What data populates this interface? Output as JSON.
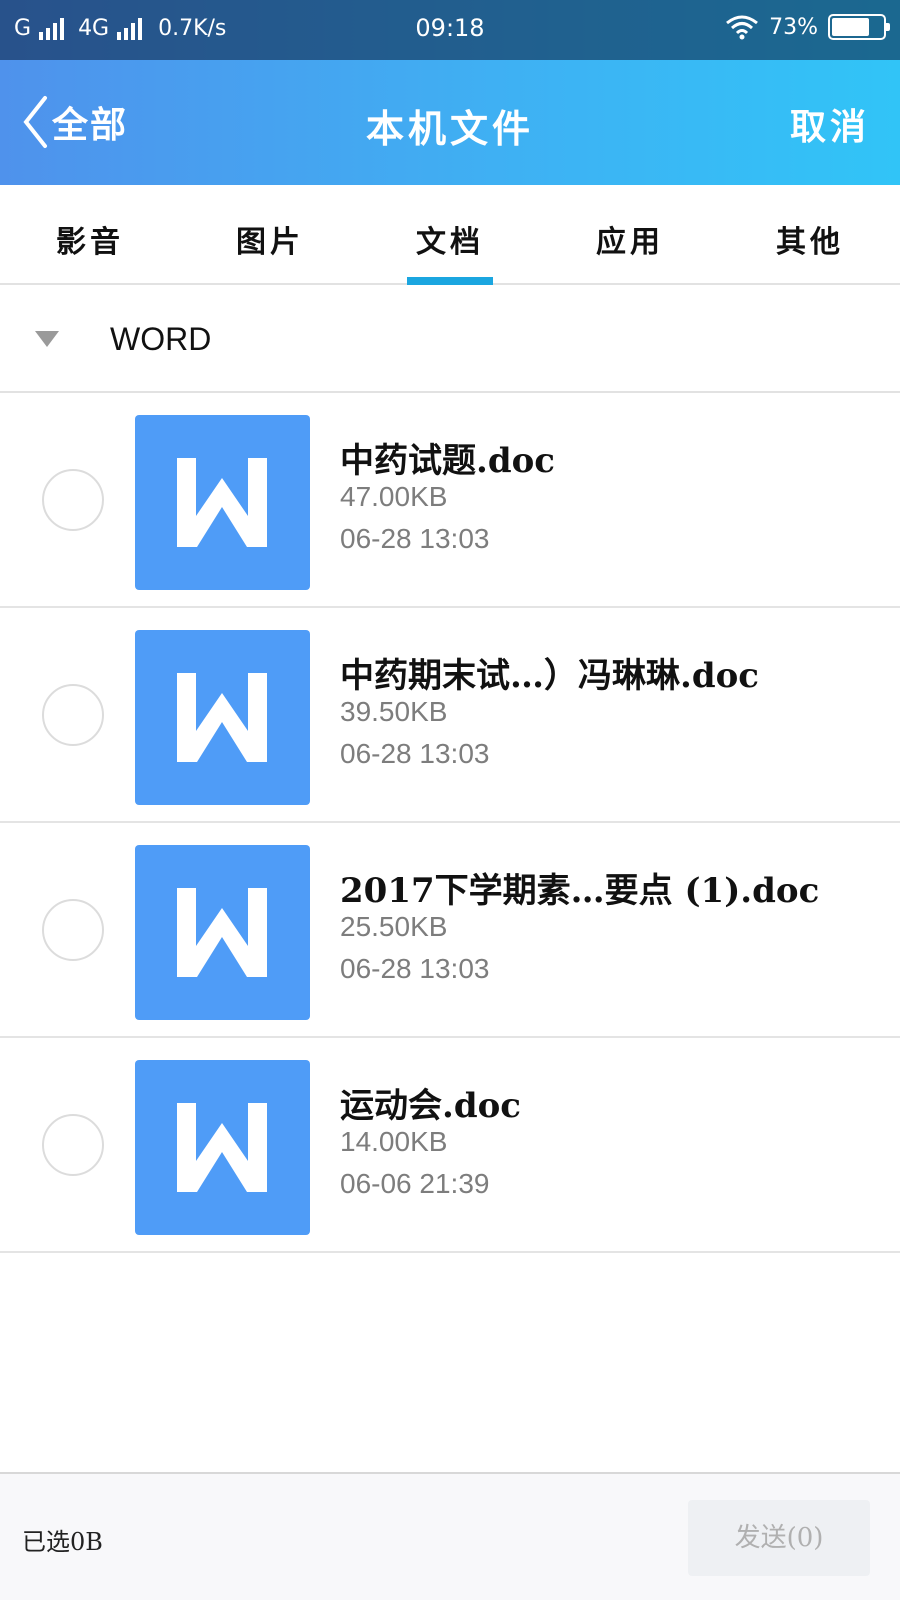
{
  "status_bar": {
    "carrier_1": "G",
    "carrier_2": "4G",
    "speed": "0.7K/s",
    "time": "09:18",
    "battery_percent": "73%",
    "battery_level": 0.73
  },
  "header": {
    "back_label": "全部",
    "title": "本机文件",
    "cancel_label": "取消"
  },
  "tabs": [
    {
      "label": "影音"
    },
    {
      "label": "图片"
    },
    {
      "label": "文档",
      "active": true
    },
    {
      "label": "应用"
    },
    {
      "label": "其他"
    }
  ],
  "section": {
    "label": "WORD"
  },
  "files": [
    {
      "name": "中药试题.doc",
      "size": "47.00KB",
      "date": "06-28 13:03",
      "icon": "word-doc-icon"
    },
    {
      "name": "中药期末试…）冯琳琳.doc",
      "size": "39.50KB",
      "date": "06-28 13:03",
      "icon": "word-doc-icon"
    },
    {
      "name": "2017下学期素…要点 (1).doc",
      "size": "25.50KB",
      "date": "06-28 13:03",
      "icon": "word-doc-icon"
    },
    {
      "name": "运动会.doc",
      "size": "14.00KB",
      "date": "06-06 21:39",
      "icon": "word-doc-icon"
    }
  ],
  "bottom": {
    "selected_label": "已选0B",
    "send_label": "发送(0)"
  },
  "colors": {
    "accent": "#1ba6e0",
    "word_icon": "#4f9cf7",
    "header_gradient_start": "#4f92ec",
    "header_gradient_end": "#31c4f7"
  }
}
